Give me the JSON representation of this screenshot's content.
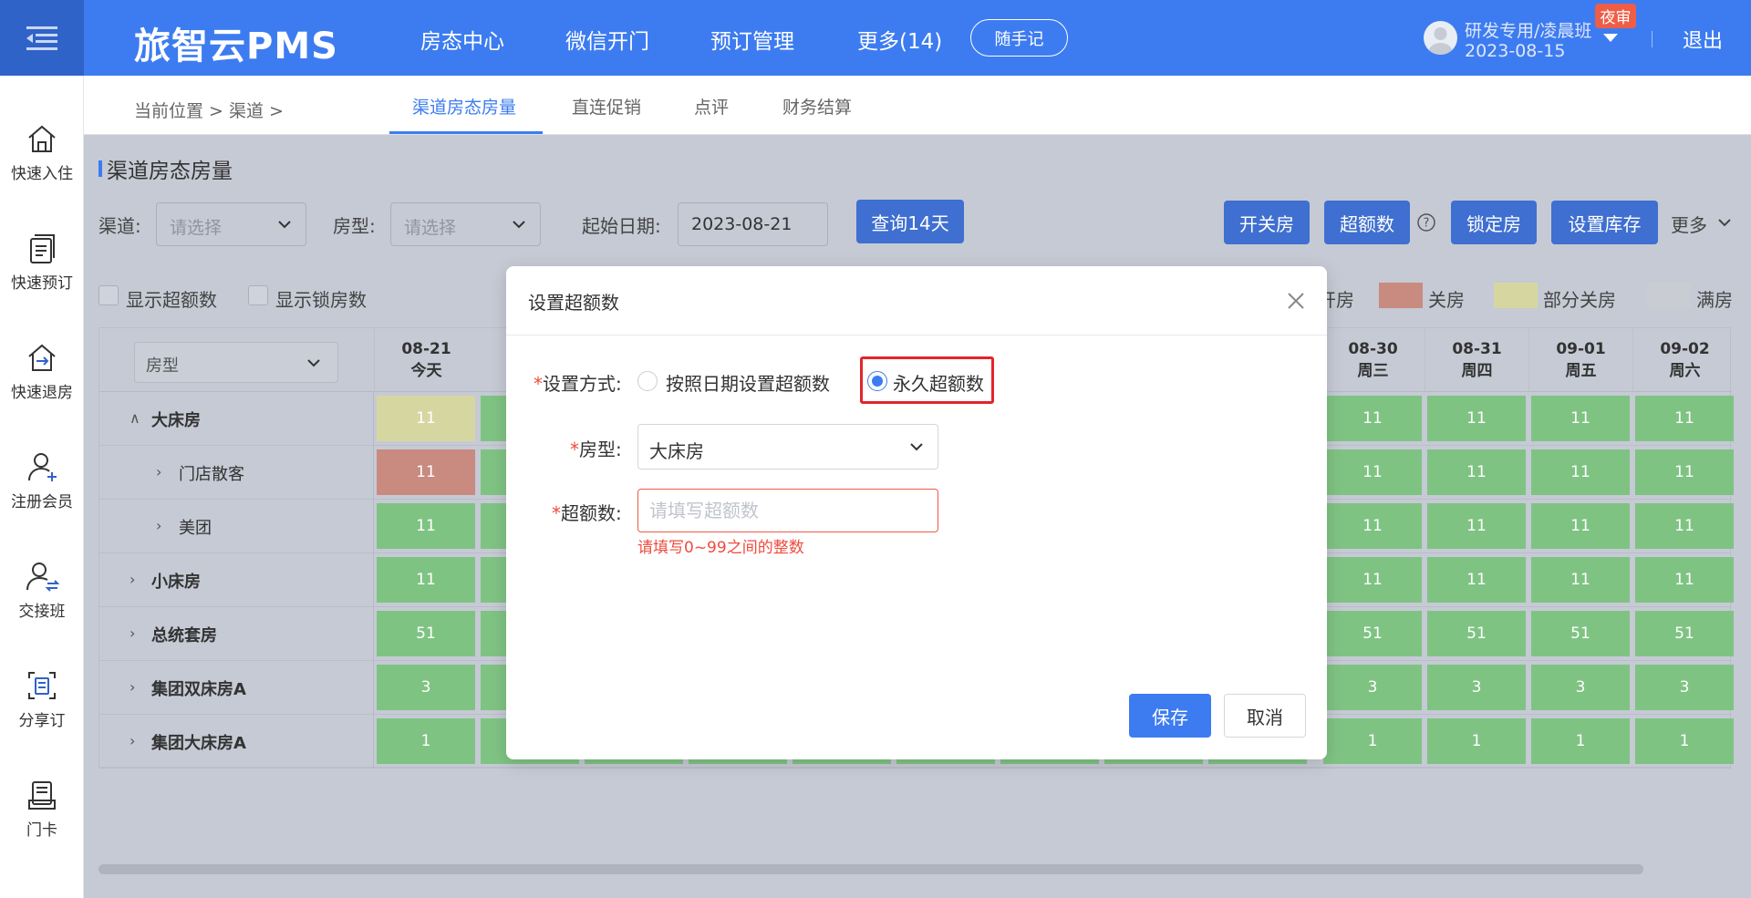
{
  "app": {
    "title": "旅智云PMS",
    "nav": [
      "房态中心",
      "微信开门",
      "预订管理",
      "更多(14)"
    ],
    "memo_button": "随手记",
    "user_name": "研发专用/凌晨班",
    "user_date": "2023-08-15",
    "night_badge": "夜审",
    "logout": "退出"
  },
  "sidebar": {
    "items": [
      {
        "label": "快速入住",
        "icon": "home-icon"
      },
      {
        "label": "快速预订",
        "icon": "booking-list-icon"
      },
      {
        "label": "快速退房",
        "icon": "checkout-house-icon"
      },
      {
        "label": "注册会员",
        "icon": "add-member-icon"
      },
      {
        "label": "交接班",
        "icon": "shift-handover-icon"
      },
      {
        "label": "分享订",
        "icon": "share-booking-icon"
      },
      {
        "label": "门卡",
        "icon": "door-card-icon"
      }
    ]
  },
  "subheader": {
    "breadcrumb": "当前位置 >  渠道  >",
    "tabs": [
      "渠道房态房量",
      "直连促销",
      "点评",
      "财务结算"
    ]
  },
  "page": {
    "title": "渠道房态房量",
    "channel_label": "渠道:",
    "channel_placeholder": "请选择",
    "roomtype_label": "房型:",
    "roomtype_placeholder": "请选择",
    "startdate_label": "起始日期:",
    "startdate_value": "2023-08-21",
    "query_button": "查询14天",
    "actions": [
      "开关房",
      "超额数",
      "锁定房",
      "设置库存"
    ],
    "more": "更多",
    "show_overbook": "显示超额数",
    "show_locked": "显示锁房数",
    "legend": [
      {
        "label": "开房",
        "color": "#7fcf86"
      },
      {
        "label": "关房",
        "color": "#d98e82"
      },
      {
        "label": "部分关房",
        "color": "#e0e0a4"
      },
      {
        "label": "满房",
        "color": "#d6d9df"
      }
    ]
  },
  "grid": {
    "roomtype_header": "房型",
    "columns": [
      {
        "date": "08-21",
        "day": "今天"
      },
      {
        "date": "08-30",
        "day": "周三"
      },
      {
        "date": "08-31",
        "day": "周四"
      },
      {
        "date": "09-01",
        "day": "周五"
      },
      {
        "date": "09-02",
        "day": "周六"
      }
    ],
    "rows": [
      {
        "name": "大床房",
        "expanded": true,
        "level": 0,
        "values": [
          "11",
          "11",
          "11",
          "11",
          "11"
        ],
        "first_color": "#e0e0a4"
      },
      {
        "name": "门店散客",
        "level": 1,
        "values": [
          "11",
          "11",
          "11",
          "11",
          "11"
        ],
        "first_color": "#d98e82"
      },
      {
        "name": "美团",
        "level": 1,
        "values": [
          "11",
          "11",
          "11",
          "11",
          "11"
        ],
        "first_color": "#7fcf86"
      },
      {
        "name": "小床房",
        "level": 0,
        "values": [
          "11",
          "11",
          "11",
          "11",
          "11"
        ],
        "first_color": "#7fcf86"
      },
      {
        "name": "总统套房",
        "level": 0,
        "values": [
          "51",
          "51",
          "51",
          "51",
          "51"
        ],
        "first_color": "#7fcf86"
      },
      {
        "name": "集团双床房A",
        "level": 0,
        "values": [
          "3",
          "3",
          "3",
          "3",
          "3"
        ],
        "first_color": "#7fcf86"
      },
      {
        "name": "集团大床房A",
        "level": 0,
        "values": [
          "1",
          "1",
          "1",
          "1",
          "1"
        ],
        "first_color": "#7fcf86"
      }
    ]
  },
  "modal": {
    "title": "设置超额数",
    "method_label": "设置方式:",
    "option_by_date": "按照日期设置超额数",
    "option_permanent": "永久超额数",
    "roomtype_label": "房型:",
    "roomtype_value": "大床房",
    "overbook_label": "超额数:",
    "overbook_placeholder": "请填写超额数",
    "error": "请填写0~99之间的整数",
    "save": "保存",
    "cancel": "取消"
  }
}
